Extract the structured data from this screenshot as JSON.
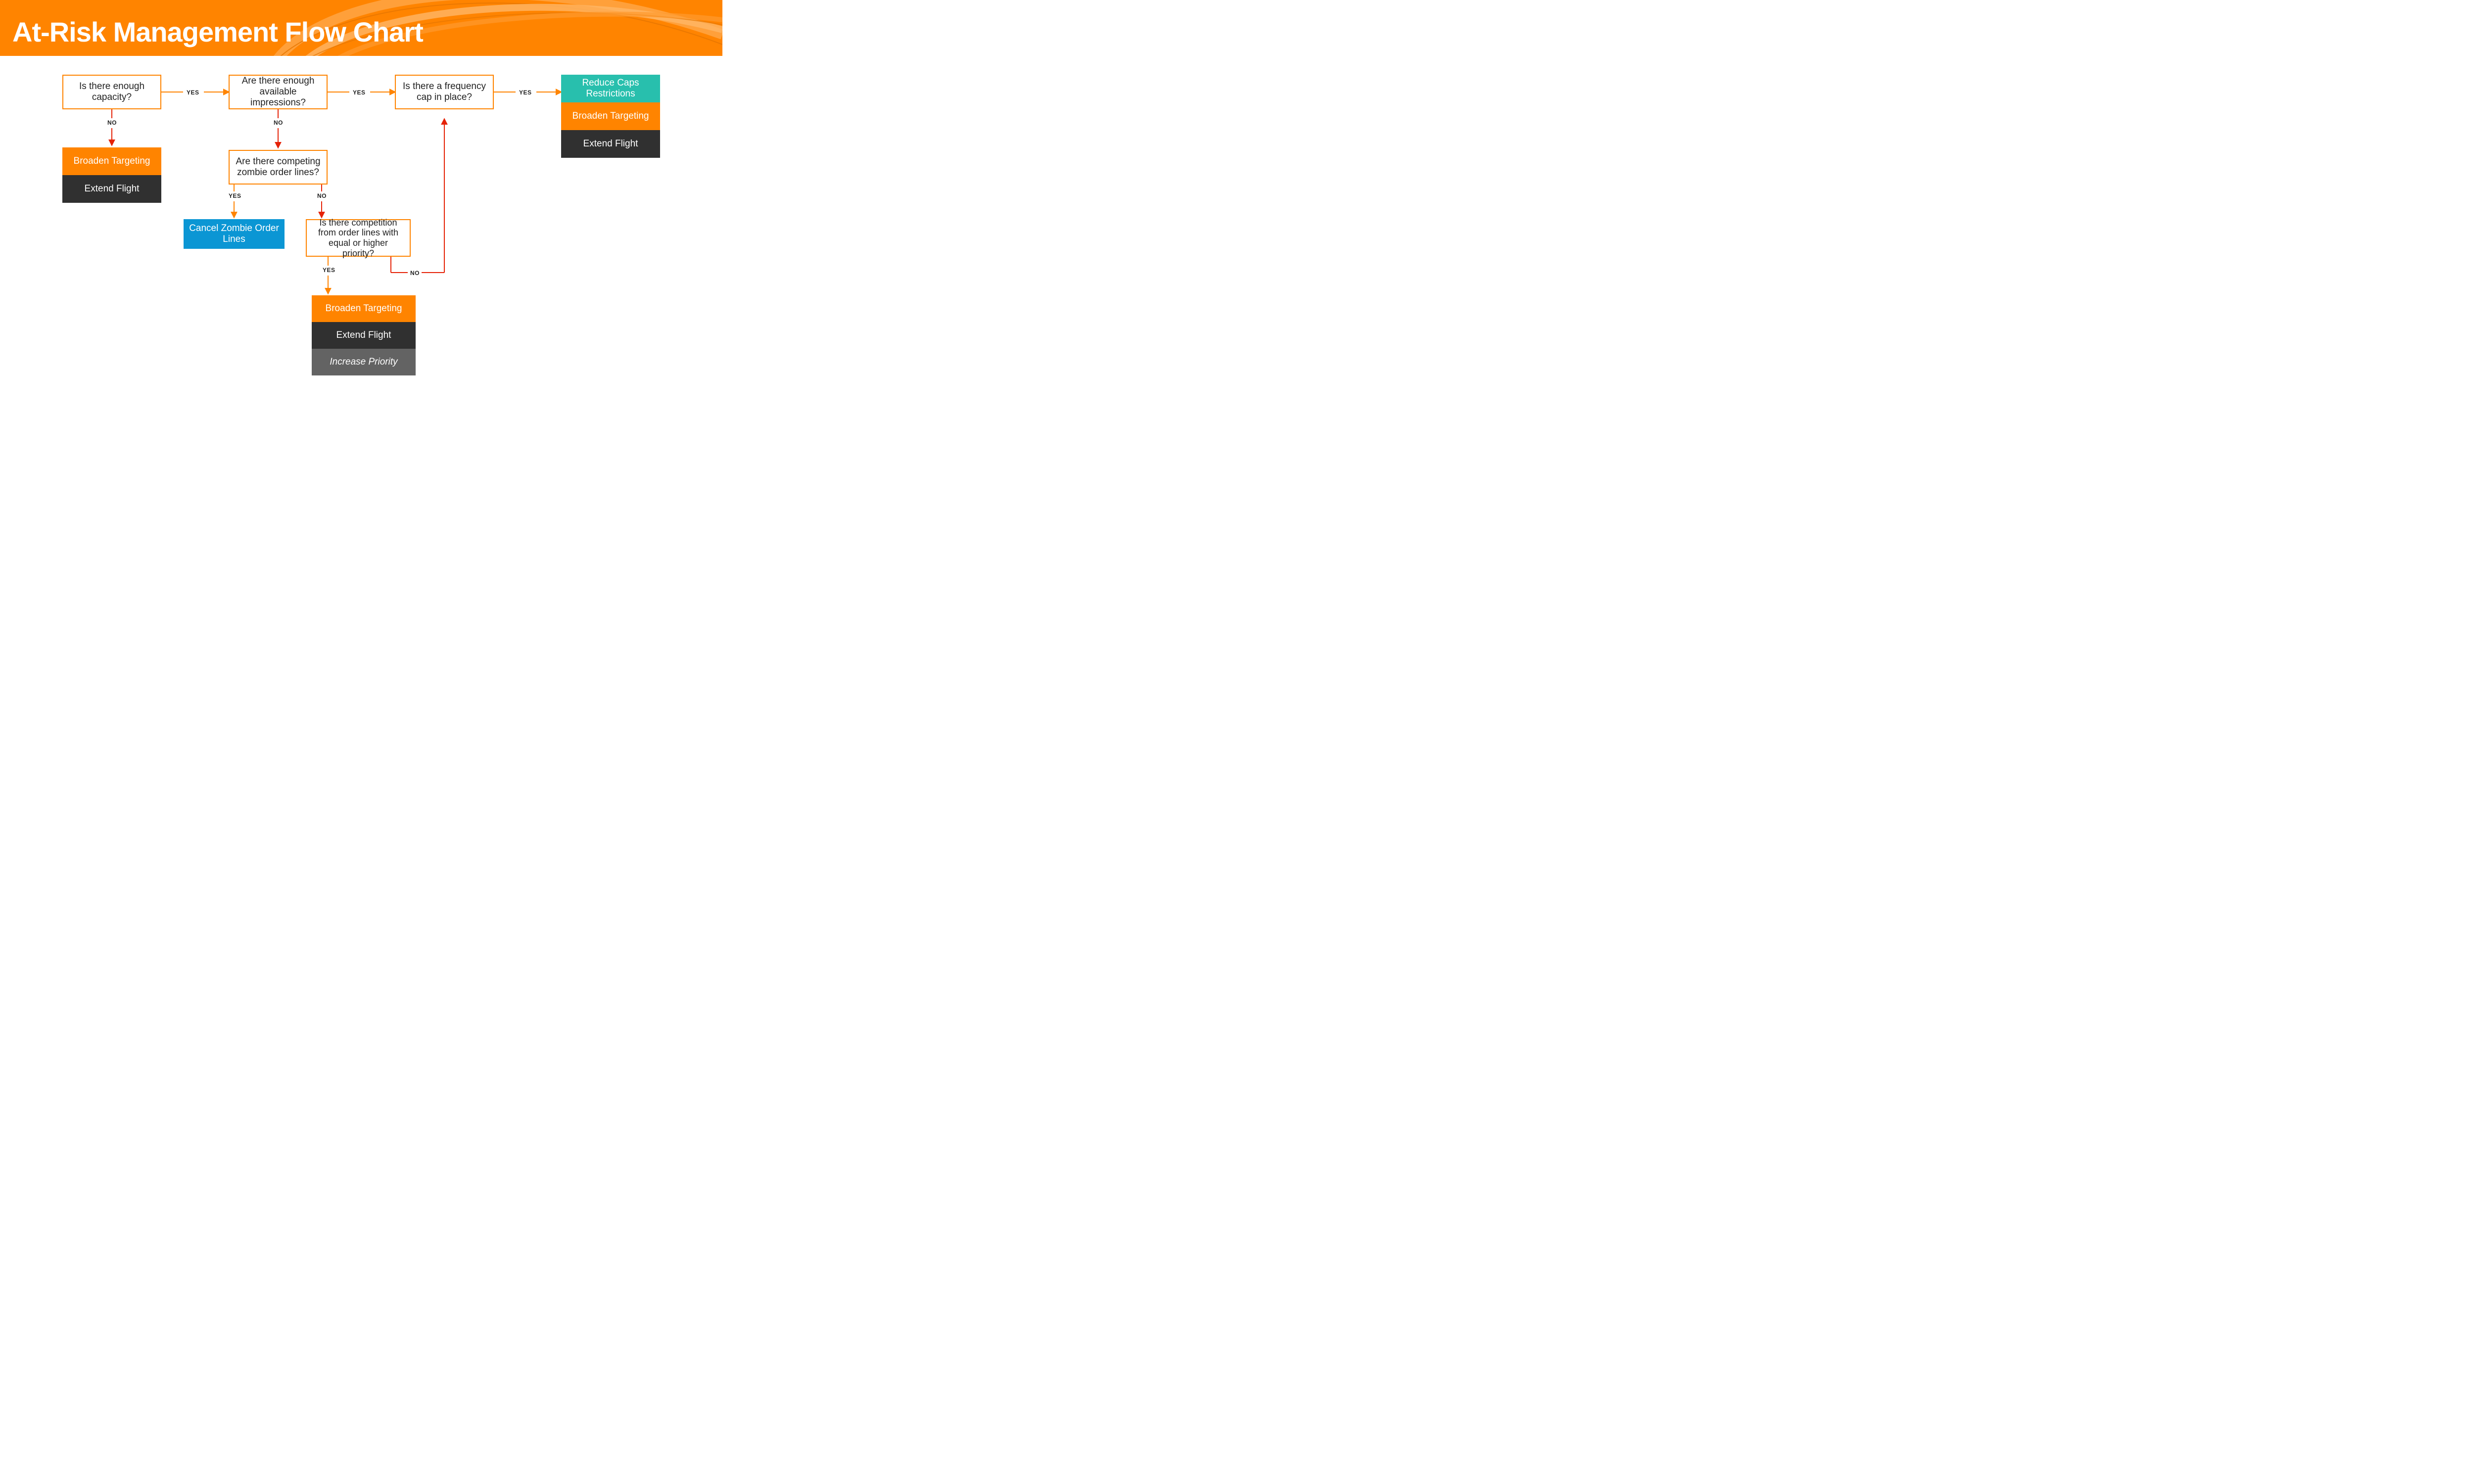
{
  "title": "At-Risk Management Flow Chart",
  "labels": {
    "yes": "YES",
    "no": "NO"
  },
  "q": {
    "capacity": "Is there enough capacity?",
    "impressions": "Are there enough available impressions?",
    "freqcap": "Is there a frequency cap in place?",
    "zombie": "Are there competing zombie order lines?",
    "priority": "Is there competition from order lines with equal or higher priority?"
  },
  "a": {
    "broaden": "Broaden Targeting",
    "extend": "Extend Flight",
    "reduce_caps": "Reduce Caps Restrictions",
    "cancel_zombie": "Cancel Zombie Order Lines",
    "increase_priority": "Increase Priority"
  }
}
